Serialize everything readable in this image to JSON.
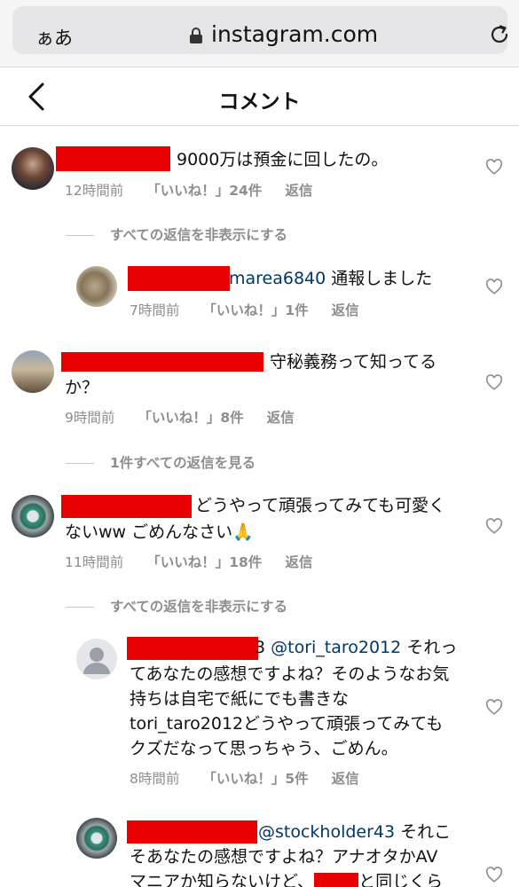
{
  "browser": {
    "aa_label": "ぁあ",
    "url": "instagram.com"
  },
  "header": {
    "title": "コメント"
  },
  "comments": [
    {
      "text": "9000万は預金に回したの。",
      "time": "12時間前",
      "likes": "「いいね！」24件",
      "reply": "返信",
      "toggle": "すべての返信を非表示にする"
    },
    {
      "handle": "marea6840",
      "text": " 通報しました",
      "time": "7時間前",
      "likes": "「いいね！」1件",
      "reply": "返信"
    },
    {
      "text_line1": "守秘義務って知ってる",
      "text_line2": "か？",
      "time": "9時間前",
      "likes": "「いいね！」8件",
      "reply": "返信",
      "toggle": "1件すべての返信を見る"
    },
    {
      "text_line1": "どうやって頑張ってみても可愛く",
      "text_line2": "ないww ごめんなさい🙏",
      "time": "11時間前",
      "likes": "「いいね！」18件",
      "reply": "返信",
      "toggle": "すべての返信を非表示にする"
    },
    {
      "prefix": "3 ",
      "handle": "@tori_taro2012",
      "text_line1": " それっ",
      "text_line2": "てあなたの感想ですよね？そのようなお気",
      "text_line3": "持ちは自宅で紙にでも書きな",
      "text_line4": "tori_taro2012どうやって頑張ってみても",
      "text_line5": "クズだなって思っちゃう、ごめん。",
      "time": "8時間前",
      "likes": "「いいね！」5件",
      "reply": "返信"
    },
    {
      "handle": "@stockholder43",
      "text_line1": " それこ",
      "text_line2": "そあなたの感想ですよね？アナオタかAV",
      "text_line3a": "マニアか知らないけど、",
      "text_line3b": "と同じくら"
    }
  ]
}
